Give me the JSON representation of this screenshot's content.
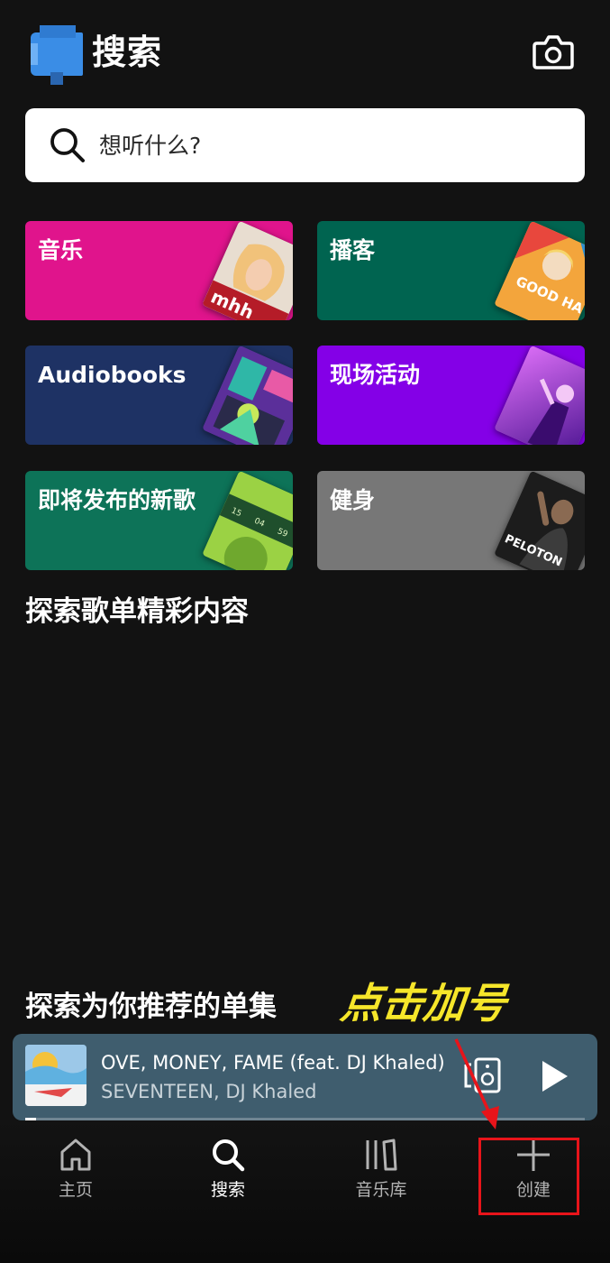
{
  "header": {
    "title": "搜索",
    "avatar_icon": "profile-avatar-icon",
    "camera_icon": "camera-icon"
  },
  "search": {
    "placeholder": "想听什么?",
    "icon": "search-icon"
  },
  "categories": [
    {
      "label": "音乐",
      "color": "#e0148c"
    },
    {
      "label": "播客",
      "color": "#006450"
    },
    {
      "label": "Audiobooks",
      "color": "#1e3264"
    },
    {
      "label": "现场活动",
      "color": "#8400e7"
    },
    {
      "label": "即将发布的新歌",
      "color": "#0d7358"
    },
    {
      "label": "健身",
      "color": "#777777"
    }
  ],
  "category_art_text": {
    "podcast_cover": "GOOD HANG",
    "fitness_cover": "PELOTON",
    "new_release_countdown": [
      "15",
      "04",
      "59"
    ]
  },
  "sections": {
    "explore_playlists": "探索歌单精彩内容",
    "explore_episodes": "探索为你推荐的单集"
  },
  "annotation": {
    "text": "点击加号",
    "color": "#f6e62a",
    "box_color": "#e8141a"
  },
  "now_playing": {
    "title": "OVE, MONEY, FAME (feat. DJ Khaled)",
    "artist": "SEVENTEEN, DJ Khaled",
    "progress": 0.02,
    "bar_color": "#3f5d6e",
    "device_icon": "connect-device-icon",
    "play_icon": "play-icon"
  },
  "nav": {
    "home": "主页",
    "search": "搜索",
    "library": "音乐库",
    "create": "创建"
  }
}
